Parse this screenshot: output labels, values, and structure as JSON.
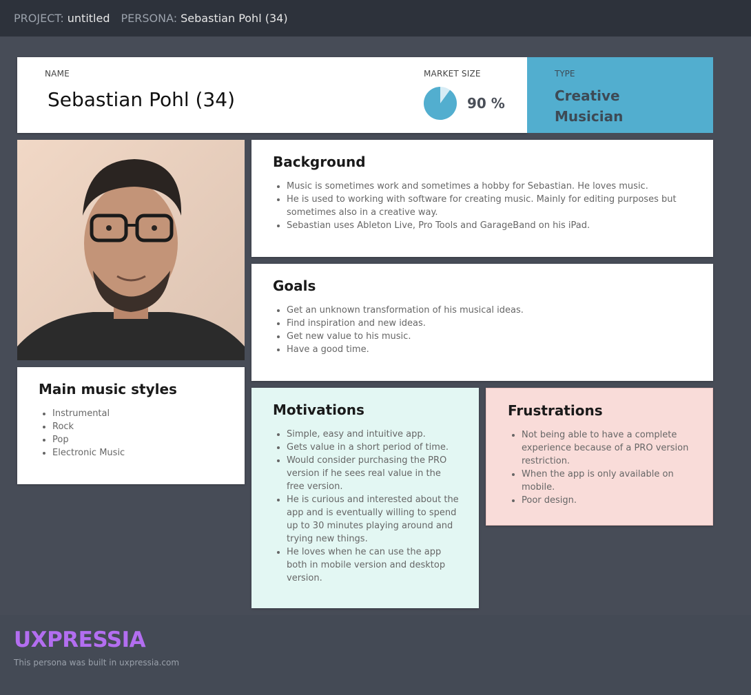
{
  "topbar": {
    "project_label": "PROJECT:",
    "project_value": "untitled",
    "persona_label": "PERSONA:",
    "persona_value": "Sebastian Pohl (34)"
  },
  "header": {
    "name_label": "NAME",
    "name_value": "Sebastian Pohl (34)",
    "market_size_label": "MARKET SIZE",
    "market_size_value": "90 %",
    "market_size_fraction": 0.9,
    "pie_color": "#52aecf",
    "pie_rest_color": "#d6ecf5"
  },
  "type": {
    "label": "TYPE",
    "value": "Creative Musician",
    "background": "#52aecf"
  },
  "photo": {
    "alt": "portrait-photo"
  },
  "background": {
    "title": "Background",
    "items": [
      "Music is sometimes work and sometimes a hobby for Sebastian. He loves music.",
      "He is used to working with software for creating music. Mainly for editing purposes but sometimes also in a creative way.",
      "Sebastian uses Ableton Live, Pro Tools and GarageBand on his iPad."
    ]
  },
  "goals": {
    "title": "Goals",
    "items": [
      "Get an unknown transformation of his musical ideas.",
      "Find inspiration and new ideas.",
      "Get new value to his music.",
      "Have a good time."
    ]
  },
  "styles": {
    "title": "Main music styles",
    "items": [
      "Instrumental",
      "Rock",
      "Pop",
      "Electronic Music"
    ]
  },
  "motivations": {
    "title": "Motivations",
    "items": [
      "Simple, easy and intuitive app.",
      "Gets value in a short period of time.",
      "Would consider purchasing the PRO version if he sees real value in the free version.",
      "He is curious and interested about the app and is eventually willing to spend up to 30 minutes playing around and trying new things.",
      "He loves when he can use the app both in mobile version and desktop version."
    ]
  },
  "frustrations": {
    "title": "Frustrations",
    "items": [
      "Not being able to have a complete experience because of a PRO version restriction.",
      "When the app is only available on mobile.",
      "Poor design."
    ]
  },
  "footer": {
    "logo": "UXPRESSIA",
    "text": "This persona was built in uxpressia.com"
  }
}
